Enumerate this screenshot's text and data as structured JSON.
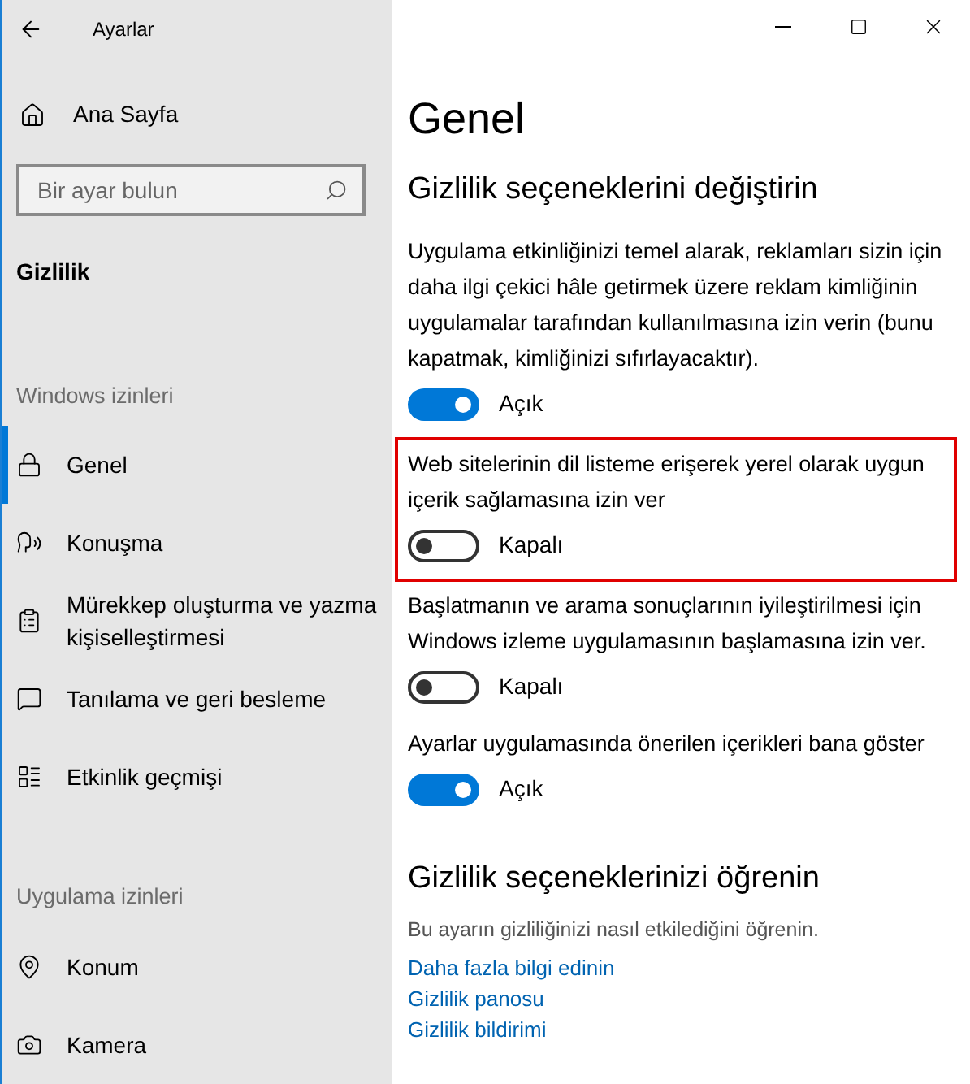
{
  "window": {
    "title": "Ayarlar"
  },
  "sidebar": {
    "home": "Ana Sayfa",
    "search": {
      "placeholder": "Bir ayar bulun"
    },
    "category": "Gizlilik",
    "sections": [
      {
        "heading": "Windows izinleri",
        "items": [
          {
            "label": "Genel",
            "selected": true
          },
          {
            "label": "Konuşma",
            "selected": false
          },
          {
            "label": "Mürekkep oluşturma ve yazma kişiselleştirmesi",
            "selected": false
          },
          {
            "label": "Tanılama ve geri besleme",
            "selected": false
          },
          {
            "label": "Etkinlik geçmişi",
            "selected": false
          }
        ]
      },
      {
        "heading": "Uygulama izinleri",
        "items": [
          {
            "label": "Konum",
            "selected": false
          },
          {
            "label": "Kamera",
            "selected": false
          }
        ]
      }
    ]
  },
  "page": {
    "title": "Genel",
    "section_title": "Gizlilik seçeneklerini değiştirin",
    "settings": [
      {
        "description": "Uygulama etkinliğinizi temel alarak, reklamları sizin için daha ilgi çekici hâle getirmek üzere reklam kimliğinin uygulamalar tarafından kullanılmasına izin verin (bunu kapatmak, kimliğinizi sıfırlayacaktır).",
        "on": true,
        "state_label": "Açık",
        "highlighted": false
      },
      {
        "description": "Web sitelerinin dil listeme erişerek yerel olarak uygun içerik sağlamasına izin ver",
        "on": false,
        "state_label": "Kapalı",
        "highlighted": true
      },
      {
        "description": "Başlatmanın ve arama sonuçlarının iyileştirilmesi için Windows izleme uygulamasının başlamasına izin ver.",
        "on": false,
        "state_label": "Kapalı",
        "highlighted": false
      },
      {
        "description": "Ayarlar uygulamasında önerilen içerikleri bana göster",
        "on": true,
        "state_label": "Açık",
        "highlighted": false
      }
    ],
    "learn": {
      "title": "Gizlilik seçeneklerinizi öğrenin",
      "description": "Bu ayarın gizliliğinizi nasıl etkilediğini öğrenin.",
      "links": [
        "Daha fazla bilgi edinin",
        "Gizlilik panosu",
        "Gizlilik bildirimi"
      ]
    }
  }
}
